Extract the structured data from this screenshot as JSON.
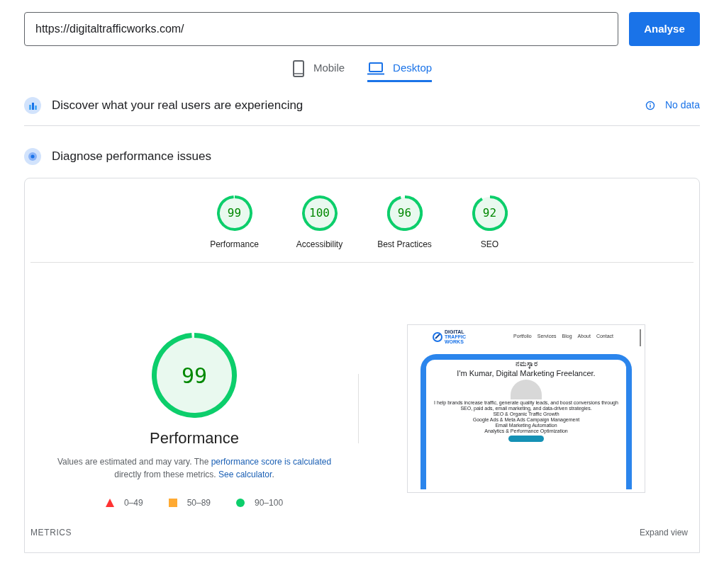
{
  "url_field": {
    "value": "https://digitaltrafficworks.com/"
  },
  "analyse_button": "Analyse",
  "tabs": [
    {
      "label": "Mobile",
      "kind": "phone",
      "selected": false
    },
    {
      "label": "Desktop",
      "kind": "laptop",
      "selected": true
    }
  ],
  "field_data": {
    "title": "Discover what your real users are experiencing",
    "status": "No data"
  },
  "diagnose": {
    "title": "Diagnose performance issues"
  },
  "scores": [
    {
      "value": "99",
      "label": "Performance",
      "level": 0.99
    },
    {
      "value": "100",
      "label": "Accessibility",
      "level": 1
    },
    {
      "value": "96",
      "label": "Best Practices",
      "level": 0.96
    },
    {
      "value": "92",
      "label": "SEO",
      "level": 0.92
    }
  ],
  "main_score": {
    "value": "99",
    "label": "Performance",
    "level": 0.99
  },
  "note": {
    "before": "Values are estimated and may vary. The ",
    "link1": "performance score is calculated",
    "middle": " directly from these metrics. ",
    "link2": "See calculator",
    "after": "."
  },
  "legend": [
    {
      "kind": "triangle",
      "label": "0–49",
      "color": "#ff3333"
    },
    {
      "kind": "square",
      "label": "50–89",
      "color": "#ffaa33"
    },
    {
      "kind": "circle",
      "label": "90–100",
      "color": "#0cce6b"
    }
  ],
  "metrics_label": "METRICS",
  "expand_view": "Expand view",
  "preview": {
    "logo_lines": [
      "DIGITAL",
      "TRAFFIC",
      "WORKS"
    ],
    "nav": [
      "Portfolio",
      "Services",
      "Blog",
      "About",
      "Contact"
    ],
    "greeting": "ನಮಸ್ಕಾರ",
    "headline": "I'm Kumar, Digital Marketing Freelancer.",
    "intro": "I help brands increase traffic, generate quality leads, and boost conversions through SEO, paid ads, email marketing, and data-driven strategies.",
    "services": [
      "SEO & Organic Traffic Growth",
      "Google Ads & Meta Ads Campaign Management",
      "Email Marketing Automation",
      "Analytics & Performance Optimization"
    ]
  }
}
